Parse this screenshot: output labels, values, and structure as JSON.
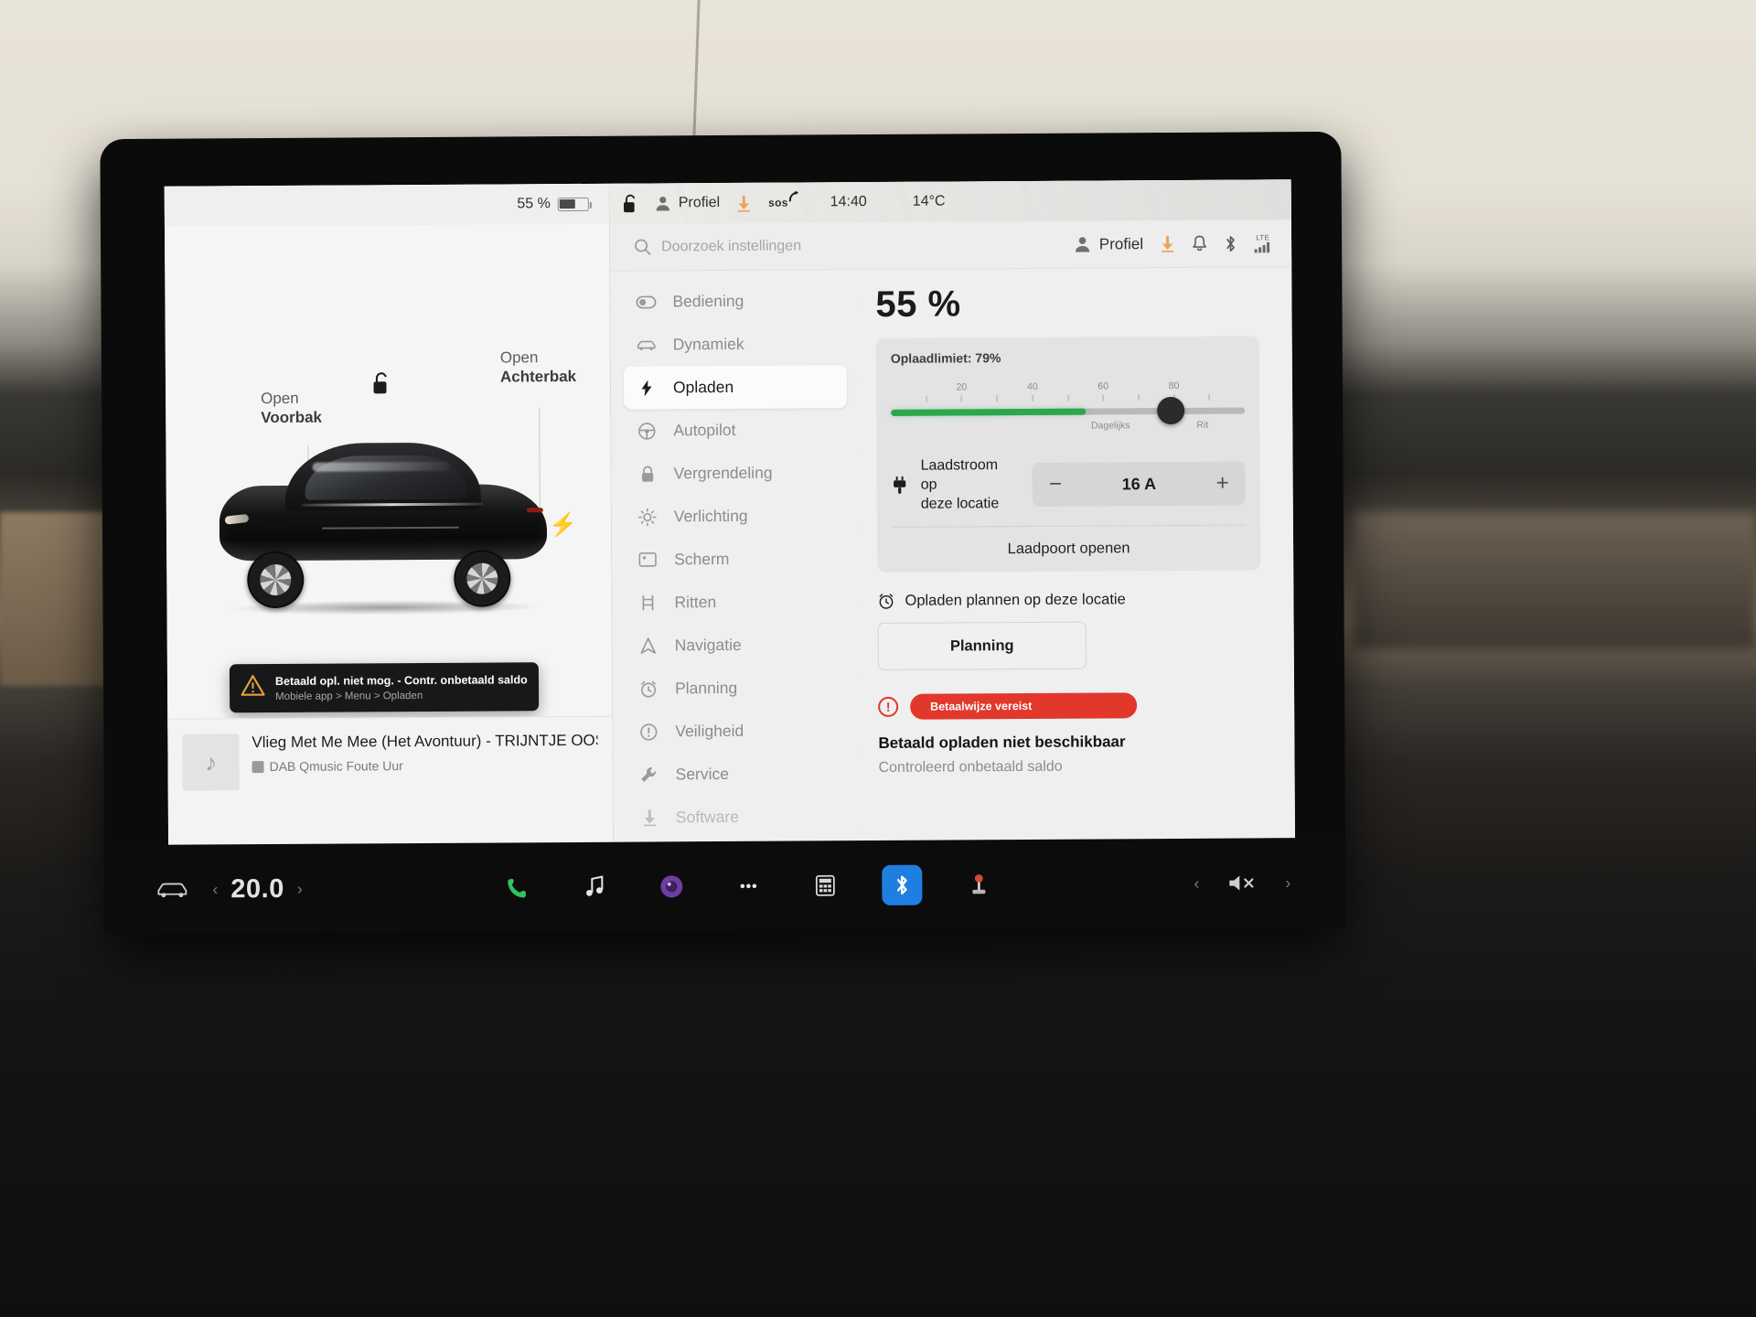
{
  "car_status_bar": {
    "battery_percent": "55 %",
    "battery_fill_ratio": 0.53,
    "lock_icon": "unlocked-padlock-icon"
  },
  "top_status_bar": {
    "battery_percent": "55 %",
    "lock_icon": "unlocked-padlock-icon",
    "profile_label": "Profiel",
    "download_icon": "download-arrow-icon",
    "sos_label": "sos",
    "time": "14:40",
    "temperature": "14°C"
  },
  "settings_header": {
    "search_placeholder": "Doorzoek instellingen",
    "search_value": "",
    "profile_label": "Profiel",
    "icons": [
      "download-arrow-icon",
      "bell-icon",
      "bluetooth-icon",
      "lte-signal-icon"
    ],
    "lte_label": "LTE"
  },
  "car_view": {
    "front_trunk": {
      "line1": "Open",
      "line2": "Voorbak"
    },
    "rear_trunk": {
      "line1": "Open",
      "line2": "Achterbak"
    },
    "charge_port_icon": "lightning-bolt-icon",
    "lock_icon": "unlocked-padlock-icon"
  },
  "toast": {
    "icon": "warning-triangle-icon",
    "title": "Betaald opl. niet mog. - Contr. onbetaald saldo",
    "subtitle": "Mobiele app > Menu > Opladen"
  },
  "media": {
    "album_icon": "music-note-icon",
    "track_title": "Vlieg Met Me Mee (Het Avontuur) - TRIJNTJE OOS",
    "station_badge": "dab-icon",
    "station": "DAB Qmusic Foute Uur",
    "controls": [
      {
        "name": "previous-track-button",
        "icon": "skip-back-icon"
      },
      {
        "name": "stop-button",
        "icon": "stop-square-icon"
      },
      {
        "name": "next-track-button",
        "icon": "skip-forward-icon"
      },
      {
        "name": "favorite-button",
        "icon": "star-icon"
      },
      {
        "name": "equalizer-button",
        "icon": "sliders-icon"
      },
      {
        "name": "media-search-button",
        "icon": "search-icon"
      }
    ]
  },
  "menu": {
    "items": [
      {
        "label": "Bediening",
        "icon": "toggle-switch-icon",
        "active": false
      },
      {
        "label": "Dynamiek",
        "icon": "car-icon",
        "active": false
      },
      {
        "label": "Opladen",
        "icon": "lightning-bolt-icon",
        "active": true
      },
      {
        "label": "Autopilot",
        "icon": "steering-wheel-icon",
        "active": false
      },
      {
        "label": "Vergrendeling",
        "icon": "padlock-icon",
        "active": false
      },
      {
        "label": "Verlichting",
        "icon": "sun-icon",
        "active": false
      },
      {
        "label": "Scherm",
        "icon": "display-icon",
        "active": false
      },
      {
        "label": "Ritten",
        "icon": "route-icon",
        "active": false
      },
      {
        "label": "Navigatie",
        "icon": "navigation-arrow-icon",
        "active": false
      },
      {
        "label": "Planning",
        "icon": "alarm-clock-icon",
        "active": false
      },
      {
        "label": "Veiligheid",
        "icon": "info-circle-icon",
        "active": false
      },
      {
        "label": "Service",
        "icon": "wrench-icon",
        "active": false
      },
      {
        "label": "Software",
        "icon": "download-arrow-icon",
        "active": false
      }
    ]
  },
  "charging": {
    "state_of_charge": "55 %",
    "limit_label": "Oplaadlimiet: 79%",
    "limit_percent": 79,
    "current_percent": 55,
    "slider": {
      "tick_numbers": [
        {
          "value": 20,
          "label": "20"
        },
        {
          "value": 40,
          "label": "40"
        },
        {
          "value": 60,
          "label": "60"
        },
        {
          "value": 80,
          "label": "80"
        }
      ],
      "tick_marks": [
        10,
        20,
        30,
        40,
        50,
        60,
        70,
        80,
        90
      ],
      "range_labels": [
        {
          "label": "Dagelijks",
          "position": 62
        },
        {
          "label": "Rit",
          "position": 88
        }
      ],
      "fill_color": "#2aa84a",
      "track_color": "#b9b9b9",
      "knob_color": "#2b2b2b"
    },
    "current_control": {
      "icon": "plug-icon",
      "label_line1": "Laadstroom op",
      "label_line2": "deze locatie",
      "decrease": "−",
      "value": "16",
      "unit": "A",
      "increase": "+"
    },
    "open_port_label": "Laadpoort openen",
    "schedule": {
      "icon": "alarm-clock-icon",
      "label": "Opladen plannen op deze locatie",
      "button_label": "Planning"
    },
    "payment_alert": {
      "icon": "alert-circle-icon",
      "badge": "Betaalwijze vereist",
      "badge_color": "#e2372b",
      "title": "Betaald opladen niet beschikbaar",
      "subtitle": "Controleerd onbetaald saldo"
    }
  },
  "dock": {
    "car_icon": "car-front-icon",
    "temp_prev": "‹",
    "temperature": "20.0",
    "temp_next": "›",
    "apps": [
      {
        "name": "phone-app-icon",
        "glyph": "✆",
        "color": "#2ec45e"
      },
      {
        "name": "music-app-icon",
        "glyph": "♫",
        "color": "#e6e6e6"
      },
      {
        "name": "camera-app-icon",
        "glyph": "◉",
        "color": "#9b6bd6"
      },
      {
        "name": "apps-grid-icon",
        "glyph": "⋯",
        "color": "#e6e6e6"
      },
      {
        "name": "calculator-app-icon",
        "glyph": "▤",
        "color": "#d8d8d8"
      },
      {
        "name": "bluetooth-app-icon",
        "glyph": "ᛗ",
        "color": "#ffffff"
      },
      {
        "name": "joystick-app-icon",
        "glyph": "⚙",
        "color": "#d24a3a"
      }
    ],
    "volume_icon": "mute-speaker-icon",
    "left_chevron": "‹",
    "right_chevron": "›"
  }
}
